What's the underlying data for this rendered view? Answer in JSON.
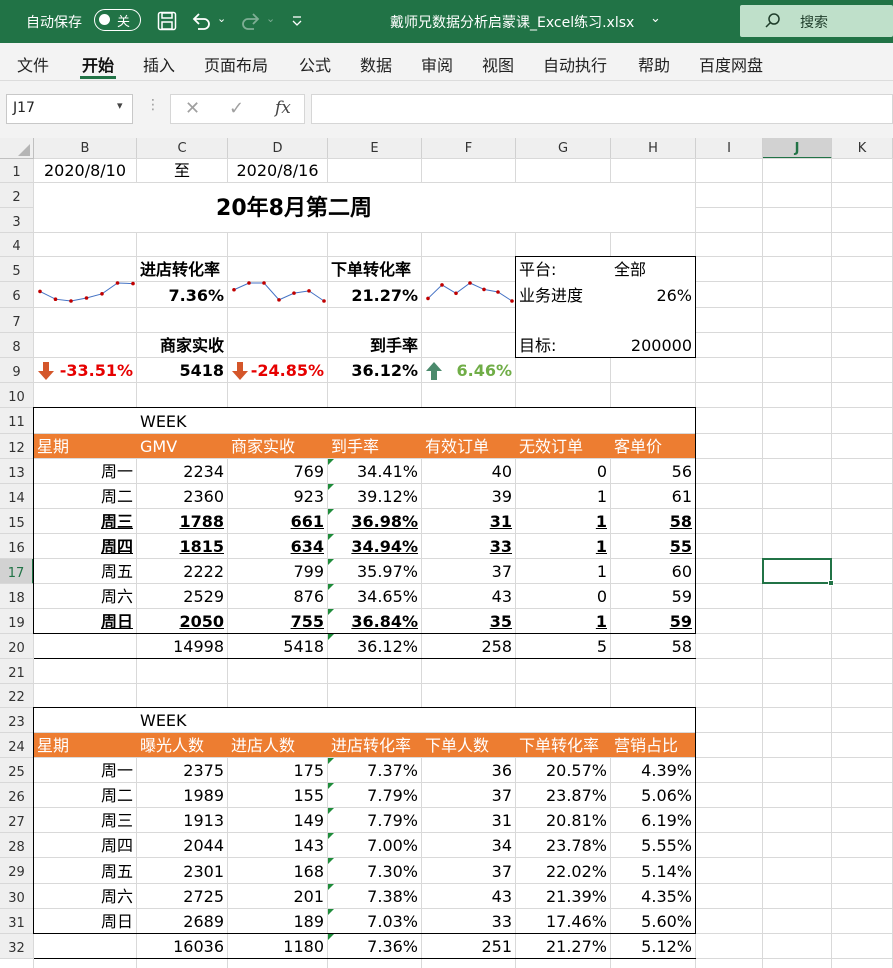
{
  "titlebar": {
    "autosave_label": "自动保存",
    "autosave_state": "关",
    "filename": "戴师兄数据分析启蒙课_Excel练习.xlsx",
    "search_label": "搜索"
  },
  "menu": [
    "文件",
    "开始",
    "插入",
    "页面布局",
    "公式",
    "数据",
    "审阅",
    "视图",
    "自动执行",
    "帮助",
    "百度网盘"
  ],
  "formula_bar": {
    "name_box": "J17",
    "fx": "fx",
    "formula": ""
  },
  "columns": [
    "B",
    "C",
    "D",
    "E",
    "F",
    "G",
    "H",
    "I",
    "J",
    "K"
  ],
  "rows": [
    "1",
    "2",
    "3",
    "4",
    "5",
    "6",
    "7",
    "8",
    "9",
    "10",
    "11",
    "12",
    "13",
    "14",
    "15",
    "16",
    "17",
    "18",
    "19",
    "20",
    "21",
    "22",
    "23",
    "24",
    "25",
    "26",
    "27",
    "28",
    "29",
    "30",
    "31",
    "32"
  ],
  "header_area": {
    "start_date": "2020/8/10",
    "to": "至",
    "end_date": "2020/8/16",
    "title": "20年8月第二周"
  },
  "kpis": {
    "k1_label": "进店转化率",
    "k1_value": "7.36%",
    "k2_label": "下单转化率",
    "k2_value": "21.27%",
    "k3_label": "商家实收",
    "k3_value": "5418",
    "k4_label": "到手率",
    "k4_value": "36.12%",
    "c1": "-33.51%",
    "c2": "-24.85%",
    "c3": "6.46%"
  },
  "panel": {
    "platform_label": "平台:",
    "platform_value": "全部",
    "progress_label": "业务进度",
    "progress_value": "26%",
    "progress_fraction": 0.26,
    "target_label": "目标:",
    "target_value": "200000"
  },
  "sparklines": {
    "s1": [
      4.5,
      3.2,
      2.9,
      3.4,
      4.1,
      5.9,
      5.8
    ],
    "s2": [
      4.8,
      6.0,
      6.0,
      3.0,
      4.2,
      4.6,
      2.8
    ],
    "s3": [
      3.5,
      5.6,
      4.3,
      5.9,
      4.9,
      4.5,
      3.1
    ]
  },
  "table1": {
    "caption": "WEEK",
    "headers": [
      "星期",
      "GMV",
      "商家实收",
      "到手率",
      "有效订单",
      "无效订单",
      "客单价"
    ],
    "rows": [
      [
        "周一",
        "2234",
        "769",
        "34.41%",
        "40",
        "0",
        "56"
      ],
      [
        "周二",
        "2360",
        "923",
        "39.12%",
        "39",
        "1",
        "61"
      ],
      [
        "周三",
        "1788",
        "661",
        "36.98%",
        "31",
        "1",
        "58"
      ],
      [
        "周四",
        "1815",
        "634",
        "34.94%",
        "33",
        "1",
        "55"
      ],
      [
        "周五",
        "2222",
        "799",
        "35.97%",
        "37",
        "1",
        "60"
      ],
      [
        "周六",
        "2529",
        "876",
        "34.65%",
        "43",
        "0",
        "59"
      ],
      [
        "周日",
        "2050",
        "755",
        "36.84%",
        "35",
        "1",
        "59"
      ]
    ],
    "bold_rows": [
      2,
      3,
      6
    ],
    "total": [
      "",
      "14998",
      "5418",
      "36.12%",
      "258",
      "5",
      "58"
    ]
  },
  "table2": {
    "caption": "WEEK",
    "headers": [
      "星期",
      "曝光人数",
      "进店人数",
      "进店转化率",
      "下单人数",
      "下单转化率",
      "营销占比"
    ],
    "rows": [
      [
        "周一",
        "2375",
        "175",
        "7.37%",
        "36",
        "20.57%",
        "4.39%"
      ],
      [
        "周二",
        "1989",
        "155",
        "7.79%",
        "37",
        "23.87%",
        "5.06%"
      ],
      [
        "周三",
        "1913",
        "149",
        "7.79%",
        "31",
        "20.81%",
        "6.19%"
      ],
      [
        "周四",
        "2044",
        "143",
        "7.00%",
        "34",
        "23.78%",
        "5.55%"
      ],
      [
        "周五",
        "2301",
        "168",
        "7.30%",
        "37",
        "22.02%",
        "5.14%"
      ],
      [
        "周六",
        "2725",
        "201",
        "7.38%",
        "43",
        "21.39%",
        "4.35%"
      ],
      [
        "周日",
        "2689",
        "189",
        "7.03%",
        "33",
        "17.46%",
        "5.60%"
      ]
    ],
    "total": [
      "",
      "16036",
      "1180",
      "7.36%",
      "251",
      "21.27%",
      "5.12%"
    ]
  }
}
